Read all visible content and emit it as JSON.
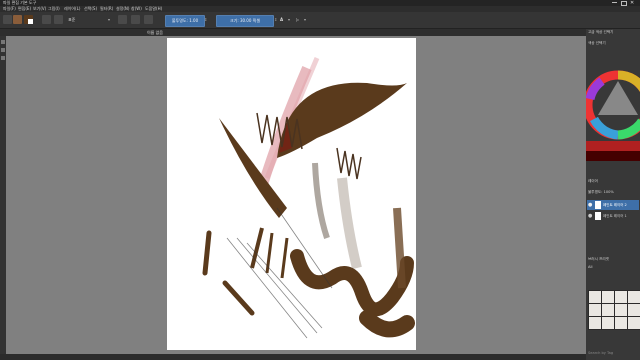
{
  "window": {
    "title": "파일 편집 기본 도구"
  },
  "menu": {
    "items": [
      "파일(F)",
      "편집(E)",
      "보기(V)",
      "그림(I)",
      "레이어(L)",
      "선택(S)",
      "필터(R)",
      "설정(N)",
      "창(W)",
      "도움말(H)"
    ]
  },
  "toolbar": {
    "blend_mode": "표준",
    "opacity_label": "불투명도: 1.00",
    "size_label": "크기: 30.00 픽셀"
  },
  "canvas": {
    "tab_label": "이름 없음"
  },
  "right_panel": {
    "top_label": "고급 색상 선택기",
    "color_panel_label": "색상 선택기",
    "layers_title": "레이어",
    "layers_header": "불투명도: 100%",
    "layers": [
      {
        "name": "페인트 레이어 2",
        "selected": true
      },
      {
        "name": "페인트 레이어 1",
        "selected": false
      }
    ],
    "brush_presets_title": "브러시 프리셋",
    "brush_tag_label": "All",
    "bottom_label": "Search by Tag"
  },
  "colors": {
    "foreground": "#5a3a1c",
    "accent": "#3e6fa8",
    "paper": "#ffffff",
    "workspace": "#808080"
  }
}
